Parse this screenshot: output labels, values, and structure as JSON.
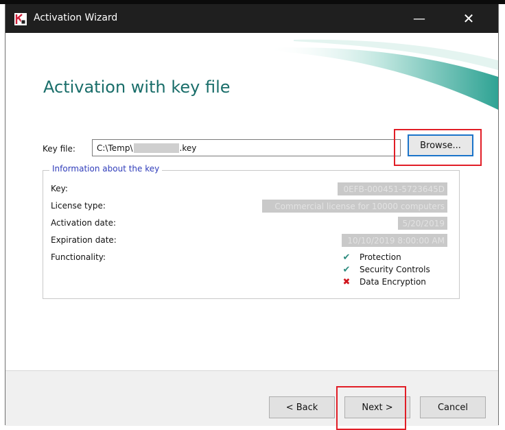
{
  "window": {
    "title": "Activation Wizard",
    "app_icon": "kaspersky-logo-icon",
    "controls": {
      "minimize": "—",
      "close": "✕"
    }
  },
  "page": {
    "title": "Activation with key file"
  },
  "key_file": {
    "label": "Key file:",
    "value_prefix": "C:\\Temp\\",
    "value_suffix": ".key",
    "browse_label": "Browse..."
  },
  "info": {
    "legend": "Information about the key",
    "rows": [
      {
        "label": "Key:",
        "value": "0EFB-000451-5723645D"
      },
      {
        "label": "License type:",
        "value": "Commercial license for 10000 computers"
      },
      {
        "label": "Activation date:",
        "value": "5/20/2019"
      },
      {
        "label": "Expiration date:",
        "value": "10/10/2019 8:00:00 AM"
      }
    ],
    "functionality_label": "Functionality:",
    "functionality": [
      {
        "name": "Protection",
        "status": "enabled",
        "icon": "checkmark-icon"
      },
      {
        "name": "Security Controls",
        "status": "enabled",
        "icon": "checkmark-icon"
      },
      {
        "name": "Data Encryption",
        "status": "disabled",
        "icon": "cross-icon"
      }
    ]
  },
  "footer": {
    "back_label": "< Back",
    "next_label": "Next >",
    "cancel_label": "Cancel"
  },
  "colors": {
    "title_teal": "#1a6e6a",
    "legend_blue": "#2f3cba",
    "highlight_red": "#e11d26",
    "focus_blue": "#1a73c9"
  }
}
